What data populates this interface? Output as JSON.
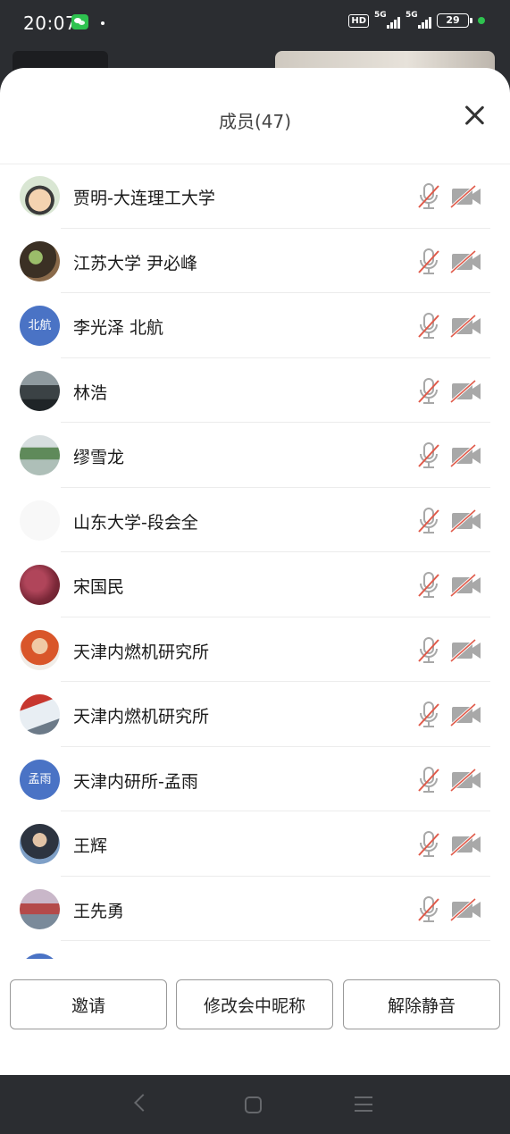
{
  "status_bar": {
    "time": "20:07",
    "hd_label": "HD",
    "network_1": "5G",
    "network_2": "5G",
    "battery": "29"
  },
  "sheet": {
    "title": "成员(47)"
  },
  "members": [
    {
      "name": "贾明-大连理工大学",
      "avatar_text": "",
      "avatar_style": "cartoon"
    },
    {
      "name": "江苏大学 尹必峰",
      "avatar_text": "",
      "avatar_style": "plant"
    },
    {
      "name": "李光泽 北航",
      "avatar_text": "北航",
      "avatar_style": "blue"
    },
    {
      "name": "林浩",
      "avatar_text": "",
      "avatar_style": "landscape-dark"
    },
    {
      "name": "缪雪龙",
      "avatar_text": "",
      "avatar_style": "lake"
    },
    {
      "name": "山东大学-段会全",
      "avatar_text": "",
      "avatar_style": "blank"
    },
    {
      "name": "宋国民",
      "avatar_text": "",
      "avatar_style": "red-texture"
    },
    {
      "name": "天津内燃机研究所",
      "avatar_text": "",
      "avatar_style": "person-orange"
    },
    {
      "name": "天津内燃机研究所",
      "avatar_text": "",
      "avatar_style": "shark"
    },
    {
      "name": "天津内研所-孟雨",
      "avatar_text": "孟雨",
      "avatar_style": "blue"
    },
    {
      "name": "王辉",
      "avatar_text": "",
      "avatar_style": "portrait"
    },
    {
      "name": "王先勇",
      "avatar_text": "",
      "avatar_style": "mountain"
    },
    {
      "name": "",
      "avatar_text": "",
      "avatar_style": "blue"
    }
  ],
  "footer": {
    "invite_label": "邀请",
    "rename_label": "修改会中昵称",
    "unmute_label": "解除静音"
  },
  "colors": {
    "muted_slash": "#e05a4a",
    "icon_gray": "#a8a8a8",
    "avatar_blue": "#4a73c5"
  }
}
